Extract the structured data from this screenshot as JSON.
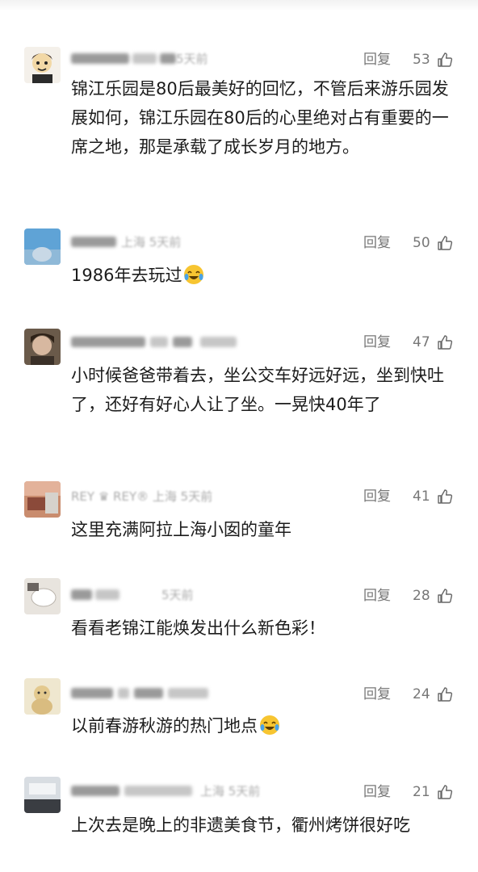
{
  "comments": [
    {
      "meta": "5天前",
      "reply": "回复",
      "likes": "53",
      "text": "锦江乐园是80后最美好的回忆，不管后来游乐园发展如何，锦江乐园在80后的心里绝对占有重要的一席之地，那是承载了成长岁月的地方。"
    },
    {
      "meta": "上海 5天前",
      "reply": "回复",
      "likes": "50",
      "text": "1986年去玩过"
    },
    {
      "meta": "",
      "reply": "回复",
      "likes": "47",
      "text": "小时候爸爸带着去，坐公交车好远好远，坐到快吐了，还好有好心人让了坐。一晃快40年了"
    },
    {
      "meta": "REY ♛ REY® 上海 5天前",
      "reply": "回复",
      "likes": "41",
      "text": "这里充满阿拉上海小囡的童年"
    },
    {
      "meta": "5天前",
      "reply": "回复",
      "likes": "28",
      "text": "看看老锦江能焕发出什么新色彩！"
    },
    {
      "meta": "",
      "reply": "回复",
      "likes": "24",
      "text": "以前春游秋游的热门地点"
    },
    {
      "meta": "上海 5天前",
      "reply": "回复",
      "likes": "21",
      "text": "上次去是晚上的非遗美食节，衢州烤饼很好吃"
    }
  ],
  "icons": {
    "like": "thumbs-up-icon",
    "emoji": "laughing-crying-emoji-icon"
  },
  "colors": {
    "secondary_text": "#777777",
    "body_text": "#1c1c1c"
  }
}
